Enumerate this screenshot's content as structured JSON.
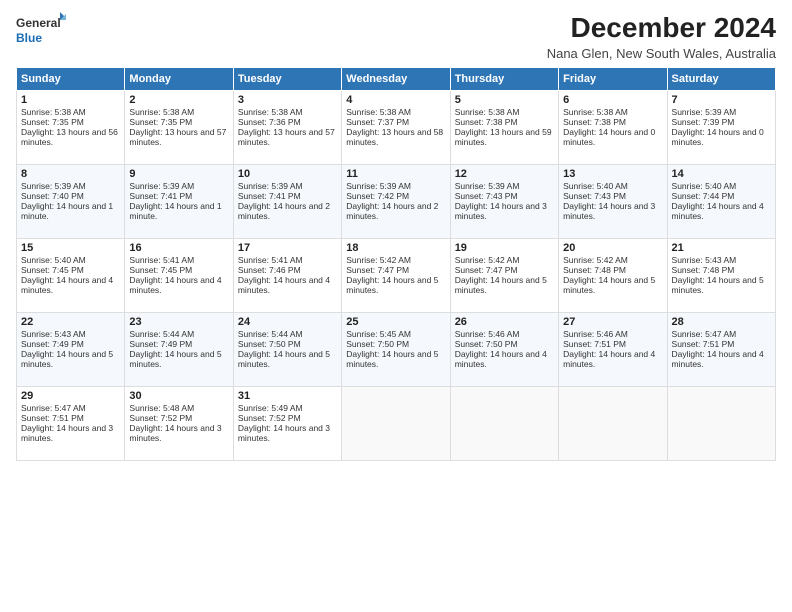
{
  "header": {
    "logo_line1": "General",
    "logo_line2": "Blue",
    "month_title": "December 2024",
    "location": "Nana Glen, New South Wales, Australia"
  },
  "days_of_week": [
    "Sunday",
    "Monday",
    "Tuesday",
    "Wednesday",
    "Thursday",
    "Friday",
    "Saturday"
  ],
  "weeks": [
    [
      {
        "day": "1",
        "sunrise": "5:38 AM",
        "sunset": "7:35 PM",
        "daylight": "13 hours and 56 minutes."
      },
      {
        "day": "2",
        "sunrise": "5:38 AM",
        "sunset": "7:35 PM",
        "daylight": "13 hours and 57 minutes."
      },
      {
        "day": "3",
        "sunrise": "5:38 AM",
        "sunset": "7:36 PM",
        "daylight": "13 hours and 57 minutes."
      },
      {
        "day": "4",
        "sunrise": "5:38 AM",
        "sunset": "7:37 PM",
        "daylight": "13 hours and 58 minutes."
      },
      {
        "day": "5",
        "sunrise": "5:38 AM",
        "sunset": "7:38 PM",
        "daylight": "13 hours and 59 minutes."
      },
      {
        "day": "6",
        "sunrise": "5:38 AM",
        "sunset": "7:38 PM",
        "daylight": "14 hours and 0 minutes."
      },
      {
        "day": "7",
        "sunrise": "5:39 AM",
        "sunset": "7:39 PM",
        "daylight": "14 hours and 0 minutes."
      }
    ],
    [
      {
        "day": "8",
        "sunrise": "5:39 AM",
        "sunset": "7:40 PM",
        "daylight": "14 hours and 1 minute."
      },
      {
        "day": "9",
        "sunrise": "5:39 AM",
        "sunset": "7:41 PM",
        "daylight": "14 hours and 1 minute."
      },
      {
        "day": "10",
        "sunrise": "5:39 AM",
        "sunset": "7:41 PM",
        "daylight": "14 hours and 2 minutes."
      },
      {
        "day": "11",
        "sunrise": "5:39 AM",
        "sunset": "7:42 PM",
        "daylight": "14 hours and 2 minutes."
      },
      {
        "day": "12",
        "sunrise": "5:39 AM",
        "sunset": "7:43 PM",
        "daylight": "14 hours and 3 minutes."
      },
      {
        "day": "13",
        "sunrise": "5:40 AM",
        "sunset": "7:43 PM",
        "daylight": "14 hours and 3 minutes."
      },
      {
        "day": "14",
        "sunrise": "5:40 AM",
        "sunset": "7:44 PM",
        "daylight": "14 hours and 4 minutes."
      }
    ],
    [
      {
        "day": "15",
        "sunrise": "5:40 AM",
        "sunset": "7:45 PM",
        "daylight": "14 hours and 4 minutes."
      },
      {
        "day": "16",
        "sunrise": "5:41 AM",
        "sunset": "7:45 PM",
        "daylight": "14 hours and 4 minutes."
      },
      {
        "day": "17",
        "sunrise": "5:41 AM",
        "sunset": "7:46 PM",
        "daylight": "14 hours and 4 minutes."
      },
      {
        "day": "18",
        "sunrise": "5:42 AM",
        "sunset": "7:47 PM",
        "daylight": "14 hours and 5 minutes."
      },
      {
        "day": "19",
        "sunrise": "5:42 AM",
        "sunset": "7:47 PM",
        "daylight": "14 hours and 5 minutes."
      },
      {
        "day": "20",
        "sunrise": "5:42 AM",
        "sunset": "7:48 PM",
        "daylight": "14 hours and 5 minutes."
      },
      {
        "day": "21",
        "sunrise": "5:43 AM",
        "sunset": "7:48 PM",
        "daylight": "14 hours and 5 minutes."
      }
    ],
    [
      {
        "day": "22",
        "sunrise": "5:43 AM",
        "sunset": "7:49 PM",
        "daylight": "14 hours and 5 minutes."
      },
      {
        "day": "23",
        "sunrise": "5:44 AM",
        "sunset": "7:49 PM",
        "daylight": "14 hours and 5 minutes."
      },
      {
        "day": "24",
        "sunrise": "5:44 AM",
        "sunset": "7:50 PM",
        "daylight": "14 hours and 5 minutes."
      },
      {
        "day": "25",
        "sunrise": "5:45 AM",
        "sunset": "7:50 PM",
        "daylight": "14 hours and 5 minutes."
      },
      {
        "day": "26",
        "sunrise": "5:46 AM",
        "sunset": "7:50 PM",
        "daylight": "14 hours and 4 minutes."
      },
      {
        "day": "27",
        "sunrise": "5:46 AM",
        "sunset": "7:51 PM",
        "daylight": "14 hours and 4 minutes."
      },
      {
        "day": "28",
        "sunrise": "5:47 AM",
        "sunset": "7:51 PM",
        "daylight": "14 hours and 4 minutes."
      }
    ],
    [
      {
        "day": "29",
        "sunrise": "5:47 AM",
        "sunset": "7:51 PM",
        "daylight": "14 hours and 3 minutes."
      },
      {
        "day": "30",
        "sunrise": "5:48 AM",
        "sunset": "7:52 PM",
        "daylight": "14 hours and 3 minutes."
      },
      {
        "day": "31",
        "sunrise": "5:49 AM",
        "sunset": "7:52 PM",
        "daylight": "14 hours and 3 minutes."
      },
      null,
      null,
      null,
      null
    ]
  ]
}
